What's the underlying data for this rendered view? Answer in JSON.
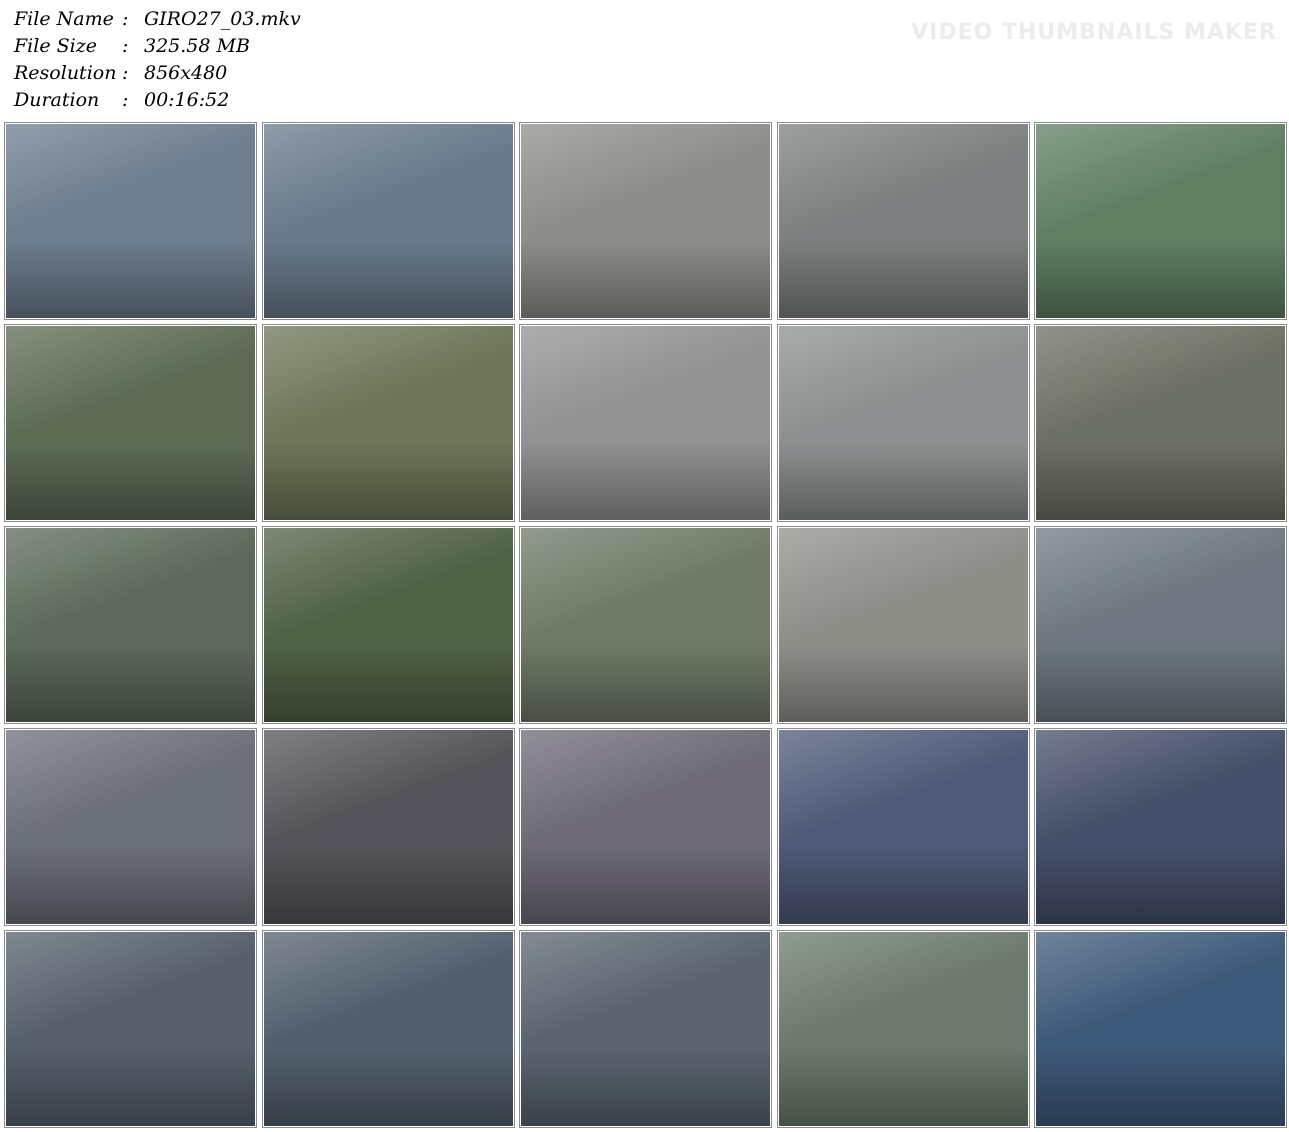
{
  "info": {
    "rows": [
      {
        "label": "File Name",
        "value": "GIRO27_03.mkv"
      },
      {
        "label": "File Size",
        "value": "325.58 MB"
      },
      {
        "label": "Resolution",
        "value": "856x480"
      },
      {
        "label": "Duration",
        "value": "00:16:52"
      }
    ],
    "separator": ":"
  },
  "watermark": "VIDEO THUMBNAILS MAKER",
  "thumbnails": {
    "columns": 5,
    "rows": 5,
    "colors": [
      [
        "#6d7d8e",
        "#697a8b",
        "#8d8d8a",
        "#7d8080",
        "#5f7f63"
      ],
      [
        "#5d6b55",
        "#6d7658",
        "#929292",
        "#8d9090",
        "#6d7064"
      ],
      [
        "#5c6a5a",
        "#4f6246",
        "#6f7a66",
        "#8f8f8a",
        "#6f7882"
      ],
      [
        "#6b6f7a",
        "#55545a",
        "#6e6a78",
        "#4e5a78",
        "#45506a"
      ],
      [
        "#55606c",
        "#52606e",
        "#5a6470",
        "#6b7a6c",
        "#3e5a7a"
      ]
    ]
  }
}
